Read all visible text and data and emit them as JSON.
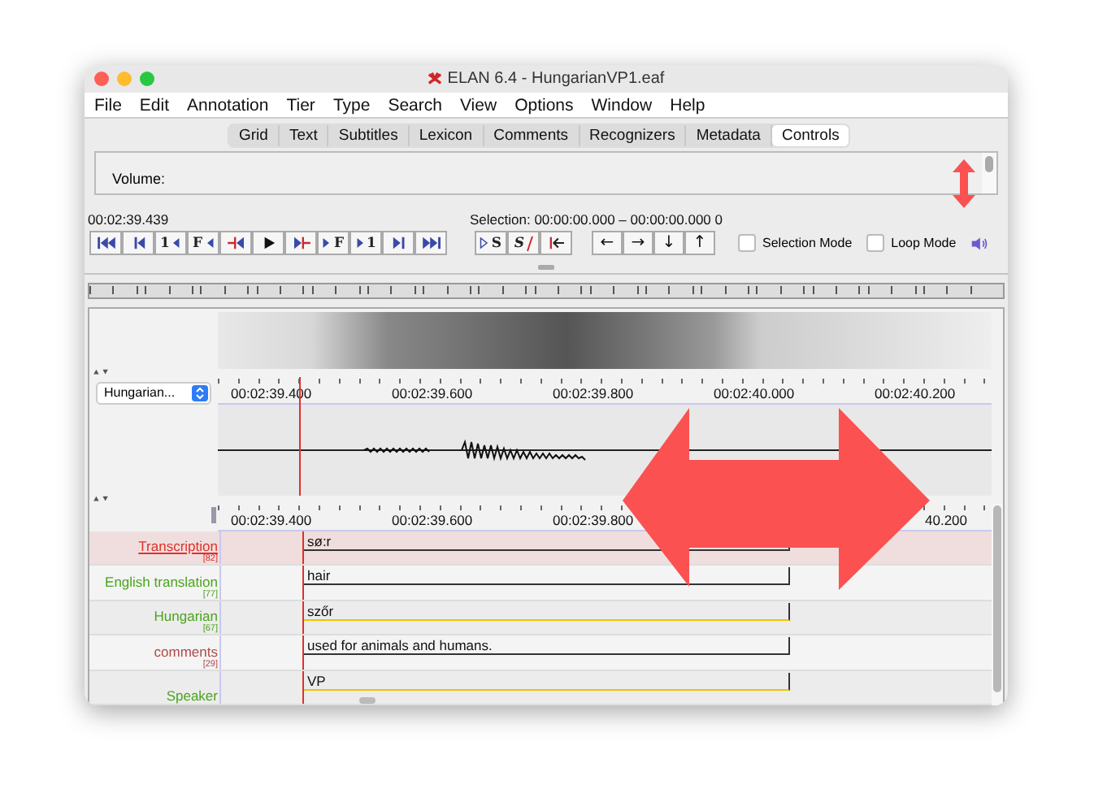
{
  "window": {
    "title": "ELAN 6.4 - HungarianVP1.eaf"
  },
  "menu": [
    "File",
    "Edit",
    "Annotation",
    "Tier",
    "Type",
    "Search",
    "View",
    "Options",
    "Window",
    "Help"
  ],
  "tabs": [
    {
      "label": "Grid",
      "selected": false
    },
    {
      "label": "Text",
      "selected": false
    },
    {
      "label": "Subtitles",
      "selected": false
    },
    {
      "label": "Lexicon",
      "selected": false
    },
    {
      "label": "Comments",
      "selected": false
    },
    {
      "label": "Recognizers",
      "selected": false
    },
    {
      "label": "Metadata",
      "selected": false
    },
    {
      "label": "Controls",
      "selected": true
    }
  ],
  "controls_panel": {
    "label": "Volume:"
  },
  "media_time": "00:02:39.439",
  "selection": "Selection: 00:00:00.000 – 00:00:00.000  0",
  "playback_buttons": [
    {
      "kind": "begin"
    },
    {
      "kind": "bar-left"
    },
    {
      "kind": "text-left",
      "text": "1"
    },
    {
      "kind": "text-left",
      "text": "F"
    },
    {
      "kind": "red-left"
    },
    {
      "kind": "play"
    },
    {
      "kind": "red-right"
    },
    {
      "kind": "text-right",
      "text": "F"
    },
    {
      "kind": "text-right",
      "text": "1"
    },
    {
      "kind": "bar-right"
    },
    {
      "kind": "end"
    }
  ],
  "selection_buttons": [
    {
      "kind": "text-right",
      "text": "S"
    },
    {
      "kind": "strike",
      "text": "S"
    },
    {
      "kind": "red-arrow-left"
    }
  ],
  "nav_buttons": [
    "←",
    "→",
    "↓",
    "↑"
  ],
  "checkboxes": [
    {
      "label": "Selection Mode",
      "checked": false
    },
    {
      "label": "Loop Mode",
      "checked": false
    }
  ],
  "waveform_viewer": {
    "tier_select": "Hungarian...",
    "ruler": [
      "00:02:39.400",
      "00:02:39.600",
      "00:02:39.800",
      "00:02:40.000",
      "00:02:40.200"
    ]
  },
  "timeline_viewer": {
    "ruler": [
      "00:02:39.400",
      "00:02:39.600",
      "00:02:39.800",
      "40.200"
    ],
    "tiers": [
      {
        "name": "Transcription",
        "count": "[82]",
        "color": "#e0302a",
        "selected": true,
        "annotation": {
          "text": "sø:r",
          "color": "#333333"
        }
      },
      {
        "name": "English translation",
        "count": "[77]",
        "color": "#4aa51c",
        "selected": false,
        "annotation": {
          "text": "hair",
          "color": "#333333"
        }
      },
      {
        "name": "Hungarian",
        "count": "[67]",
        "color": "#4aa51c",
        "selected": false,
        "annotation": {
          "text": "szőr",
          "color": "#f2c200"
        }
      },
      {
        "name": "comments",
        "count": "[29]",
        "color": "#b04a4a",
        "selected": false,
        "annotation": {
          "text": "used for animals and humans.",
          "color": "#333333"
        }
      },
      {
        "name": "Speaker",
        "color": "#4aa51c",
        "selected": false,
        "annotation": {
          "text": "VP",
          "color": "#f2c200"
        }
      }
    ]
  }
}
